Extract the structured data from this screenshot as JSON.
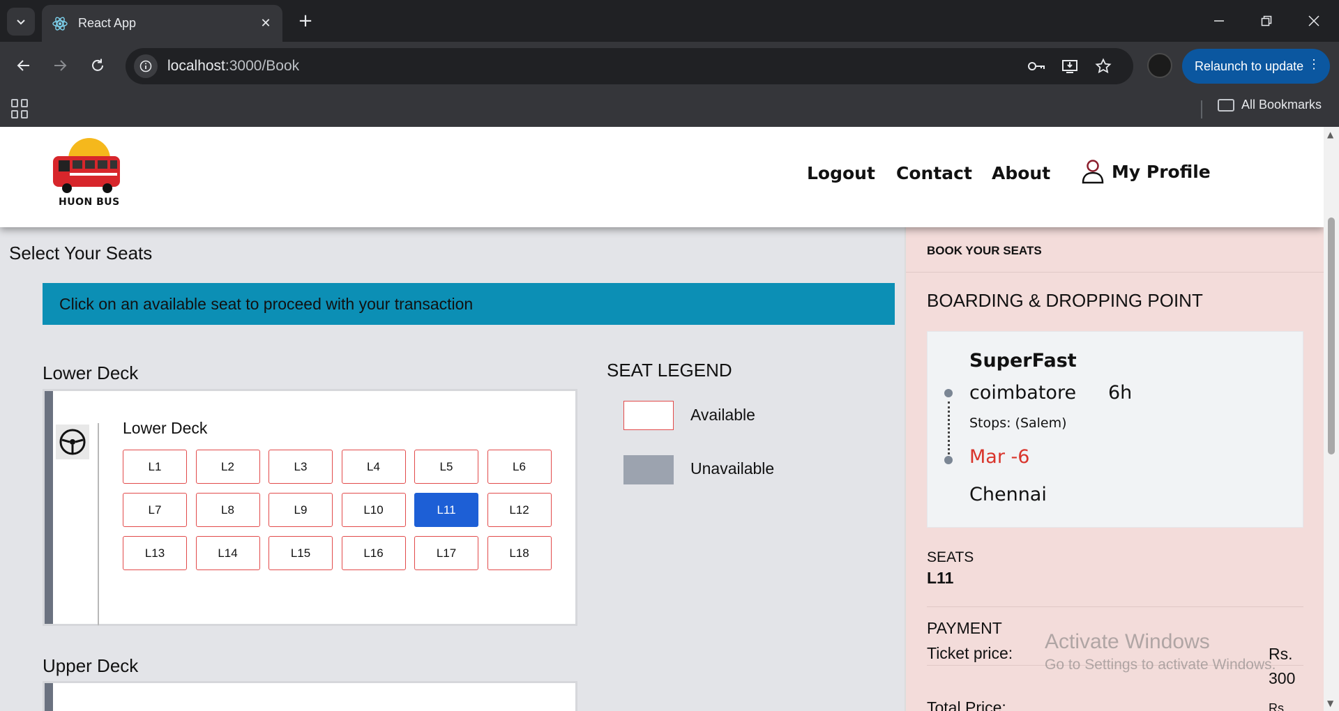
{
  "browser": {
    "tab_title": "React App",
    "url_host": "localhost",
    "url_path": ":3000/Book",
    "relaunch_label": "Relaunch to update",
    "all_bookmarks": "All Bookmarks"
  },
  "header": {
    "logo_text": "HUON BUS",
    "nav": [
      "Logout",
      "Contact",
      "About"
    ],
    "profile_label": "My Profile"
  },
  "main": {
    "title": "Select Your Seats",
    "banner": "Click on an available seat to proceed with your transaction",
    "lower_deck": {
      "title": "Lower Deck",
      "inner_title": "Lower Deck",
      "seats": [
        "L1",
        "L2",
        "L3",
        "L4",
        "L5",
        "L6",
        "L7",
        "L8",
        "L9",
        "L10",
        "L11",
        "L12",
        "L13",
        "L14",
        "L15",
        "L16",
        "L17",
        "L18"
      ],
      "selected": "L11"
    },
    "upper_deck": {
      "title": "Upper Deck"
    },
    "legend": {
      "title": "SEAT LEGEND",
      "available": "Available",
      "unavailable": "Unavailable"
    }
  },
  "side": {
    "heading": "BOOK YOUR SEATS",
    "title": "BOARDING & DROPPING POINT",
    "bus_name": "SuperFast",
    "from": "coimbatore",
    "duration": "6h",
    "stops": "Stops: (Salem)",
    "date": "Mar -6",
    "to": "Chennai",
    "seats_label": "SEATS",
    "seats_value": "L11",
    "payment_label": "PAYMENT",
    "ticket_price_label": "Ticket price:",
    "ticket_price_currency": "Rs.",
    "ticket_price_value": "300",
    "total_price_label": "Total Price:",
    "total_price_currency": "Rs."
  },
  "watermark": {
    "line1": "Activate Windows",
    "line2": "Go to Settings to activate Windows."
  },
  "colors": {
    "banner": "#0c8fb5",
    "selected_seat": "#1d5fd6",
    "seat_border": "#e24a4a",
    "side_bg": "#f3dcda",
    "date_red": "#d9342b"
  }
}
